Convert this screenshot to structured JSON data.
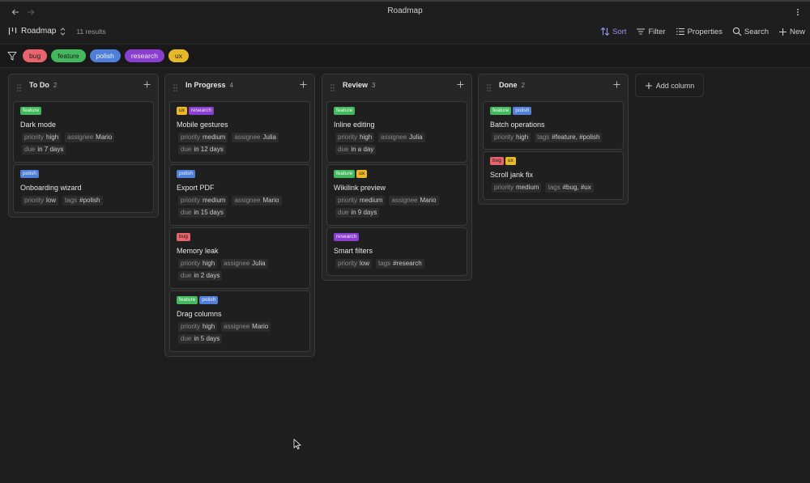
{
  "window": {
    "title": "Roadmap"
  },
  "toolbar": {
    "view_name": "Roadmap",
    "result_count": "11 results",
    "sort_label": "Sort",
    "filter_label": "Filter",
    "properties_label": "Properties",
    "search_label": "Search",
    "new_label": "New"
  },
  "filter_chips": [
    "bug",
    "feature",
    "polish",
    "research",
    "ux"
  ],
  "columns": [
    {
      "name": "To Do",
      "count": "2",
      "cards": [
        {
          "tags": [
            "feature"
          ],
          "title": "Dark mode",
          "rows": [
            [
              {
                "k": "priority",
                "v": "high"
              },
              {
                "k": "assignee",
                "v": "Mario"
              }
            ],
            [
              {
                "k": "due",
                "v": "in 7 days"
              }
            ]
          ]
        },
        {
          "tags": [
            "polish"
          ],
          "title": "Onboarding wizard",
          "rows": [
            [
              {
                "k": "priority",
                "v": "low"
              },
              {
                "k": "tags",
                "v": "#polish"
              }
            ]
          ]
        }
      ]
    },
    {
      "name": "In Progress",
      "count": "4",
      "cards": [
        {
          "tags": [
            "ux",
            "research"
          ],
          "title": "Mobile gestures",
          "rows": [
            [
              {
                "k": "priority",
                "v": "medium"
              },
              {
                "k": "assignee",
                "v": "Julia"
              }
            ],
            [
              {
                "k": "due",
                "v": "in 12 days"
              }
            ]
          ]
        },
        {
          "tags": [
            "polish"
          ],
          "title": "Export PDF",
          "rows": [
            [
              {
                "k": "priority",
                "v": "medium"
              },
              {
                "k": "assignee",
                "v": "Mario"
              }
            ],
            [
              {
                "k": "due",
                "v": "in 15 days"
              }
            ]
          ]
        },
        {
          "tags": [
            "bug"
          ],
          "title": "Memory leak",
          "rows": [
            [
              {
                "k": "priority",
                "v": "high"
              },
              {
                "k": "assignee",
                "v": "Julia"
              }
            ],
            [
              {
                "k": "due",
                "v": "in 2 days"
              }
            ]
          ]
        },
        {
          "tags": [
            "feature",
            "polish"
          ],
          "title": "Drag columns",
          "rows": [
            [
              {
                "k": "priority",
                "v": "high"
              },
              {
                "k": "assignee",
                "v": "Mario"
              }
            ],
            [
              {
                "k": "due",
                "v": "in 5 days"
              }
            ]
          ]
        }
      ]
    },
    {
      "name": "Review",
      "count": "3",
      "cards": [
        {
          "tags": [
            "feature"
          ],
          "title": "Inline editing",
          "rows": [
            [
              {
                "k": "priority",
                "v": "high"
              },
              {
                "k": "assignee",
                "v": "Julia"
              }
            ],
            [
              {
                "k": "due",
                "v": "in a day"
              }
            ]
          ]
        },
        {
          "tags": [
            "feature",
            "ux"
          ],
          "title": "Wikilink preview",
          "rows": [
            [
              {
                "k": "priority",
                "v": "medium"
              },
              {
                "k": "assignee",
                "v": "Mario"
              }
            ],
            [
              {
                "k": "due",
                "v": "in 9 days"
              }
            ]
          ]
        },
        {
          "tags": [
            "research"
          ],
          "title": "Smart filters",
          "rows": [
            [
              {
                "k": "priority",
                "v": "low"
              },
              {
                "k": "tags",
                "v": "#research"
              }
            ]
          ]
        }
      ]
    },
    {
      "name": "Done",
      "count": "2",
      "cards": [
        {
          "tags": [
            "feature",
            "polish"
          ],
          "title": "Batch operations",
          "rows": [
            [
              {
                "k": "priority",
                "v": "high"
              },
              {
                "k": "tags",
                "v": "#feature, #polish"
              }
            ]
          ]
        },
        {
          "tags": [
            "bug",
            "ux"
          ],
          "title": "Scroll jank fix",
          "rows": [
            [
              {
                "k": "priority",
                "v": "medium"
              },
              {
                "k": "tags",
                "v": "#bug, #ux"
              }
            ]
          ]
        }
      ]
    }
  ],
  "add_column_label": "Add column",
  "colors": {
    "accent": "#9b93f0",
    "bug": "#e9656e",
    "feature": "#44b85d",
    "polish": "#4f7fd9",
    "research": "#8a3fd1",
    "ux": "#e9b826"
  }
}
